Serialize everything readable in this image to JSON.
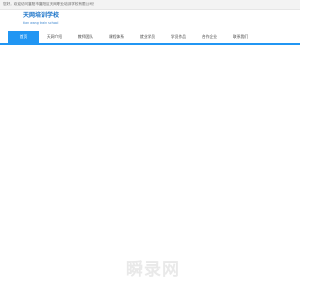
{
  "topbar": {
    "text": "您好，欢迎访问襄阳市襄阳区天网职业培训学校有限公司！"
  },
  "logo": {
    "title": "天网培训学校",
    "subtitle": "tian wang train school"
  },
  "nav": {
    "items": [
      {
        "label": "首页",
        "active": true
      },
      {
        "label": "天网介绍",
        "active": false
      },
      {
        "label": "教师团队",
        "active": false
      },
      {
        "label": "课程体系",
        "active": false
      },
      {
        "label": "就业学员",
        "active": false
      },
      {
        "label": "学员作品",
        "active": false
      },
      {
        "label": "合作企业",
        "active": false
      },
      {
        "label": "联系我们",
        "active": false
      }
    ]
  },
  "watermark": {
    "text": "瞬录网"
  },
  "colors": {
    "accent": "#2196f3",
    "logo": "#1a73c8"
  }
}
